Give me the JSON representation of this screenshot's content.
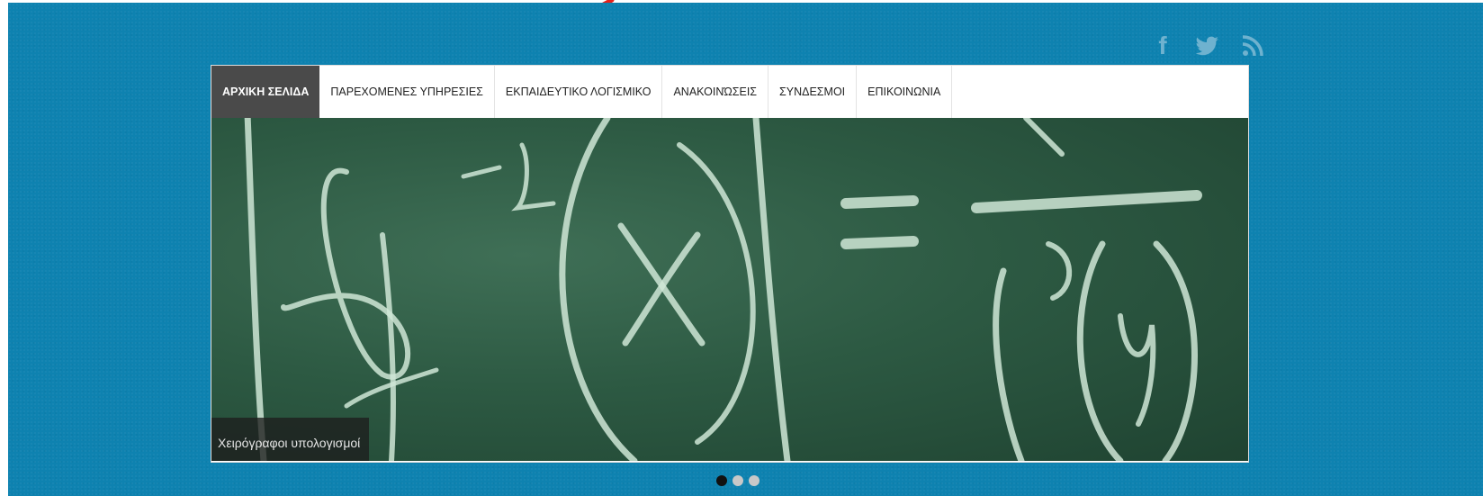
{
  "menu": {
    "items": [
      {
        "label": "ΑΡΧΙΚΗ ΣΕΛΙΔΑ",
        "active": true
      },
      {
        "label": "ΠΑΡΕΧΟΜΕΝΕΣ ΥΠΗΡΕΣΙΕΣ",
        "active": false
      },
      {
        "label": "ΕΚΠΑΙΔΕΥΤΙΚΟ ΛΟΓΙΣΜΙΚΟ",
        "active": false
      },
      {
        "label": "ΑΝΑΚΟΙΝΏΣΕΙΣ",
        "active": false
      },
      {
        "label": "ΣΥΝΔΕΣΜΟΙ",
        "active": false
      },
      {
        "label": "ΕΠΙΚΟΙΝΩΝΙΑ",
        "active": false
      }
    ]
  },
  "social": {
    "icons": [
      "facebook-icon",
      "twitter-icon",
      "rss-icon"
    ],
    "facebook_glyph": "f"
  },
  "slider": {
    "caption": "Χειρόγραφοι υπολογισμοί",
    "slide_count": 3,
    "active_index": 0
  },
  "colors": {
    "banner": "#0e82b0",
    "menu_active_bg": "#4a4a4a",
    "annotation_arrow": "#e8211a",
    "social_icon": "#6fb2cf"
  }
}
